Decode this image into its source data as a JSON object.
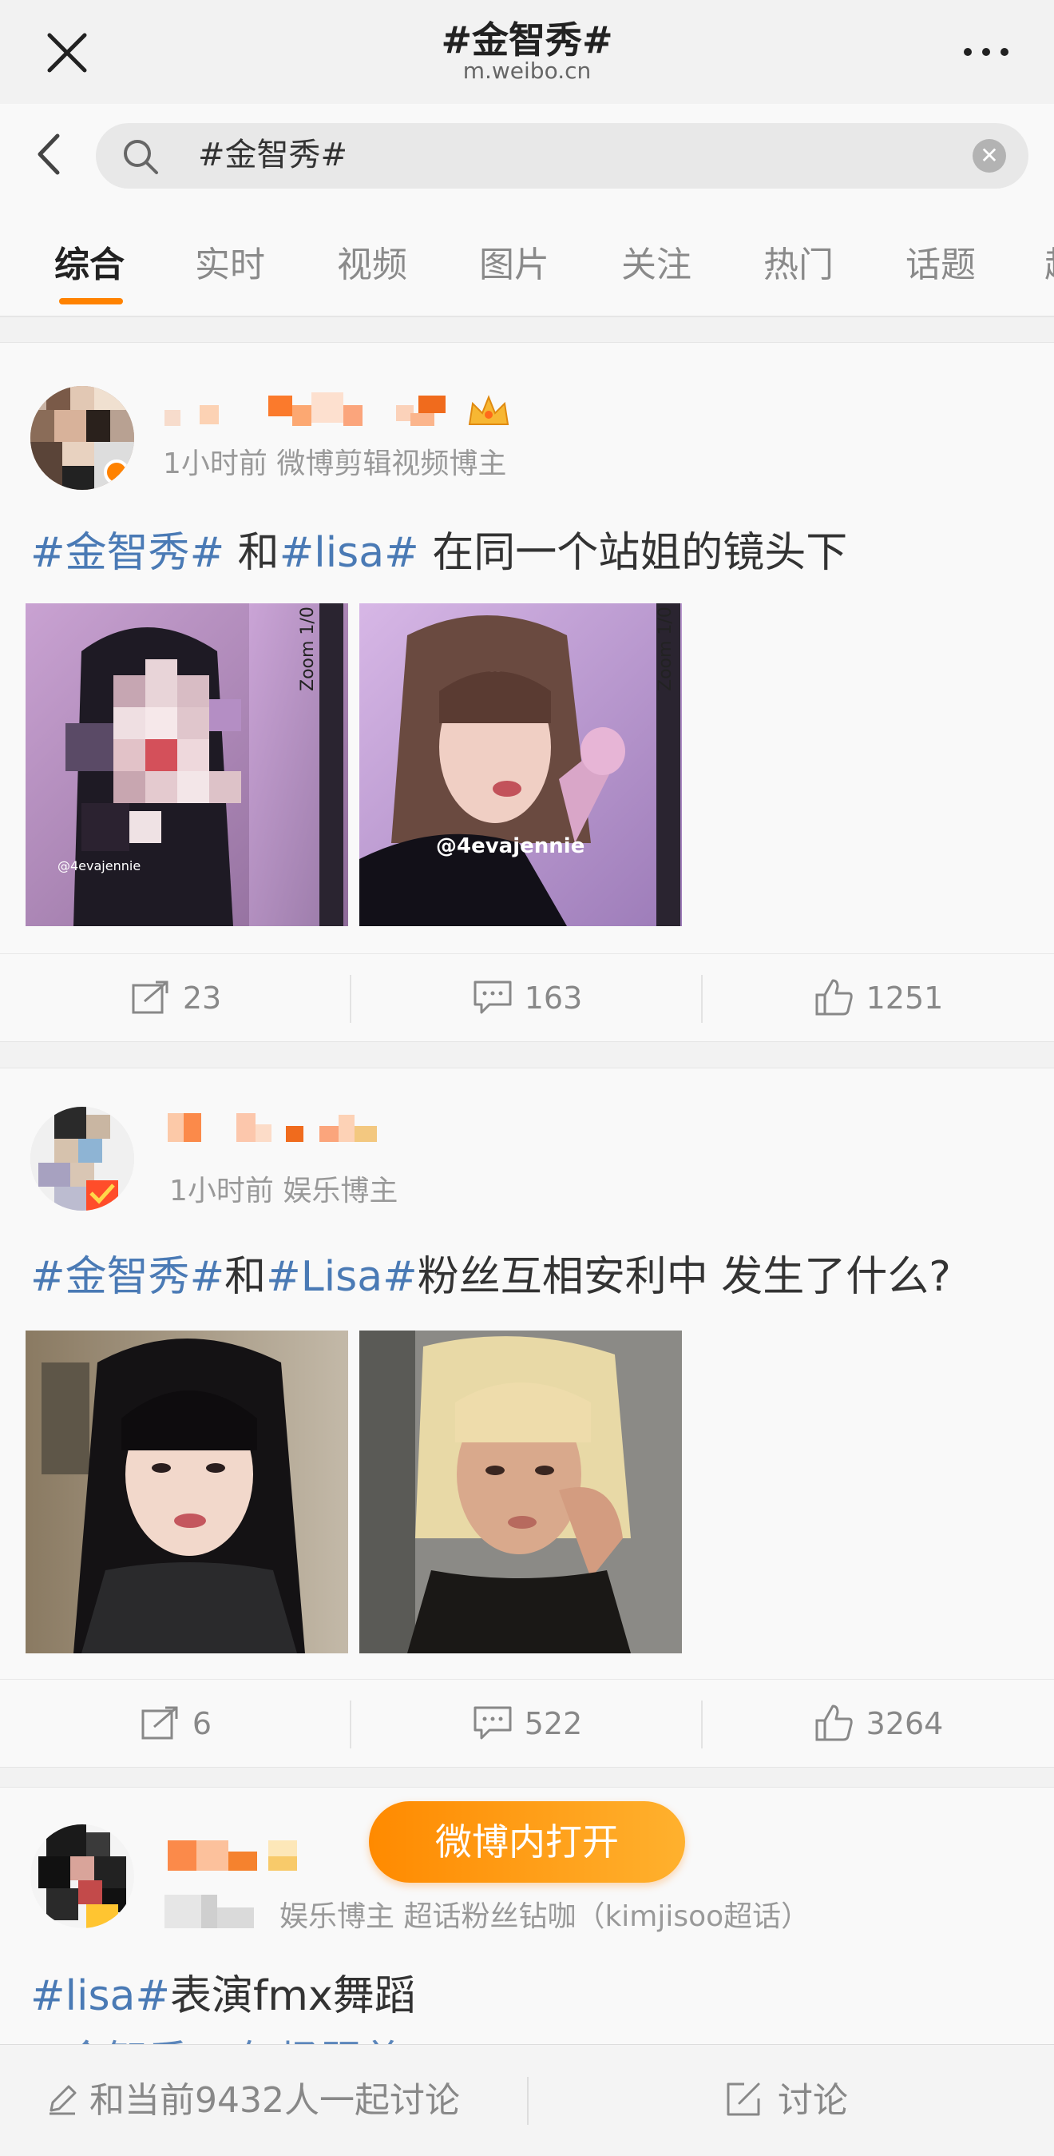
{
  "window": {
    "title": "#金智秀#",
    "url": "m.weibo.cn"
  },
  "search": {
    "value": "#金智秀#"
  },
  "tabs": [
    {
      "label": "综合",
      "active": true
    },
    {
      "label": "实时"
    },
    {
      "label": "视频"
    },
    {
      "label": "图片"
    },
    {
      "label": "关注"
    },
    {
      "label": "热门"
    },
    {
      "label": "话题"
    },
    {
      "label": "超"
    }
  ],
  "posts": [
    {
      "meta": "1小时前 微博剪辑视频博主",
      "text_parts": [
        {
          "t": "#金智秀#",
          "tag": true
        },
        {
          "t": " 和"
        },
        {
          "t": "#lisa#",
          "tag": true
        },
        {
          "t": " 在同一个站姐的镜头下"
        }
      ],
      "image_watermarks": [
        "@4evajennie",
        "@4evajennie"
      ],
      "reposts": "23",
      "comments": "163",
      "likes": "1251"
    },
    {
      "meta": "1小时前 娱乐博主",
      "text_parts": [
        {
          "t": "#金智秀#",
          "tag": true
        },
        {
          "t": "和"
        },
        {
          "t": "#Lisa#",
          "tag": true
        },
        {
          "t": "粉丝互相安利中 发生了什么?"
        }
      ],
      "reposts": "6",
      "comments": "522",
      "likes": "3264"
    },
    {
      "meta": "娱乐博主 超话粉丝钻咖（kimjisoo超话）",
      "text_parts": [
        {
          "t": "#lisa#",
          "tag": true
        },
        {
          "t": "表演fmx舞蹈"
        }
      ],
      "text_line2": "#金智秀# 气场跟着"
    }
  ],
  "open_button": "微博内打开",
  "bottom": {
    "discuss_prompt": "和当前9432人一起讨论",
    "discuss_button": "讨论"
  },
  "colors": {
    "accent": "#ff8200",
    "tag": "#4a7ab5"
  }
}
